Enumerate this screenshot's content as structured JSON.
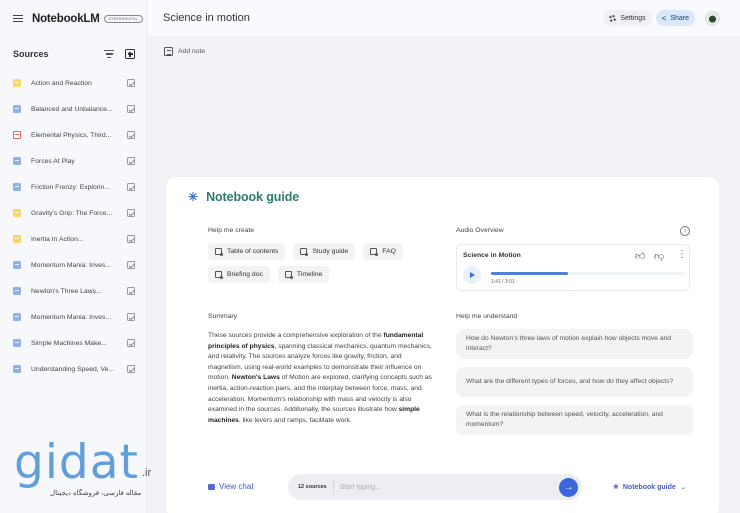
{
  "app": {
    "name": "NotebookLM",
    "badge": "Experimental"
  },
  "sidebar": {
    "title": "Sources",
    "sources": [
      {
        "label": "Action and Reaction",
        "type": "yellow",
        "checked": true
      },
      {
        "label": "Balanced and Unbalance...",
        "type": "blue",
        "checked": true
      },
      {
        "label": "Elemental Physics, Third...",
        "type": "red",
        "checked": true
      },
      {
        "label": "Forces At Play",
        "type": "blue",
        "checked": true
      },
      {
        "label": "Friction Frenzy: Explorin...",
        "type": "blue",
        "checked": true
      },
      {
        "label": "Gravity's Grip: The Force...",
        "type": "yellow",
        "checked": true
      },
      {
        "label": "Inertia In Action...",
        "type": "yellow",
        "checked": true
      },
      {
        "label": "Momentum Mania: Inves...",
        "type": "blue",
        "checked": true
      },
      {
        "label": "Newton's Three Laws...",
        "type": "blue",
        "checked": true
      },
      {
        "label": "Momentum Mania: Inves...",
        "type": "blue",
        "checked": true
      },
      {
        "label": "Simple Machines Make...",
        "type": "blue",
        "checked": true
      },
      {
        "label": "Understanding Speed, Ve...",
        "type": "blue",
        "checked": true
      }
    ]
  },
  "header": {
    "notebook_title": "Science in motion",
    "settings_label": "Settings",
    "share_label": "Share"
  },
  "notes": {
    "add_note_label": "Add note"
  },
  "guide": {
    "title": "Notebook guide",
    "help_create_label": "Help me create",
    "create_chips": [
      "Table of contents",
      "Study guide",
      "FAQ",
      "Briefing doc",
      "Timeline"
    ],
    "audio": {
      "section_label": "Audio Overview",
      "title": "Science in Motion",
      "time": "1:41 / 3:01",
      "progress_fraction": 0.4
    },
    "summary_label": "Summary",
    "summary_parts": [
      {
        "t": "These sources provide a comprehensive exploration of the ",
        "b": false
      },
      {
        "t": "fundamental principles of physics",
        "b": true
      },
      {
        "t": ", spanning classical mechanics, quantum mechanics, and relativity. The sources analyze forces like gravity, friction, and magnetism, using real-world examples to demonstrate their influence on motion. ",
        "b": false
      },
      {
        "t": "Newton's Laws",
        "b": true
      },
      {
        "t": " of Motion are explored, clarifying concepts such as inertia, action-reaction pairs, and the interplay between force, mass, and acceleration. Momentum's relationship with mass and velocity is also examined in the sources. Additionally, the sources illustrate how ",
        "b": false
      },
      {
        "t": "simple machines",
        "b": true
      },
      {
        "t": ", like levers and ramps, facilitate work.",
        "b": false
      }
    ],
    "understand_label": "Help me understand",
    "questions": [
      "How do Newton's three laws of motion explain how objects move and interact?",
      "What are the different types of forces, and how do they affect objects?",
      "What is the relationship between speed, velocity, acceleration, and momentum?"
    ]
  },
  "chat": {
    "view_chat_label": "View chat",
    "source_count": "12 sources",
    "input_placeholder": "Start typing...",
    "input_value": "",
    "guide_toggle_label": "Notebook guide"
  },
  "watermark": {
    "logo": "gidat",
    "tld": ".ir",
    "subtitle": "مقاله فارسی، فروشگاه دیجیتال"
  }
}
